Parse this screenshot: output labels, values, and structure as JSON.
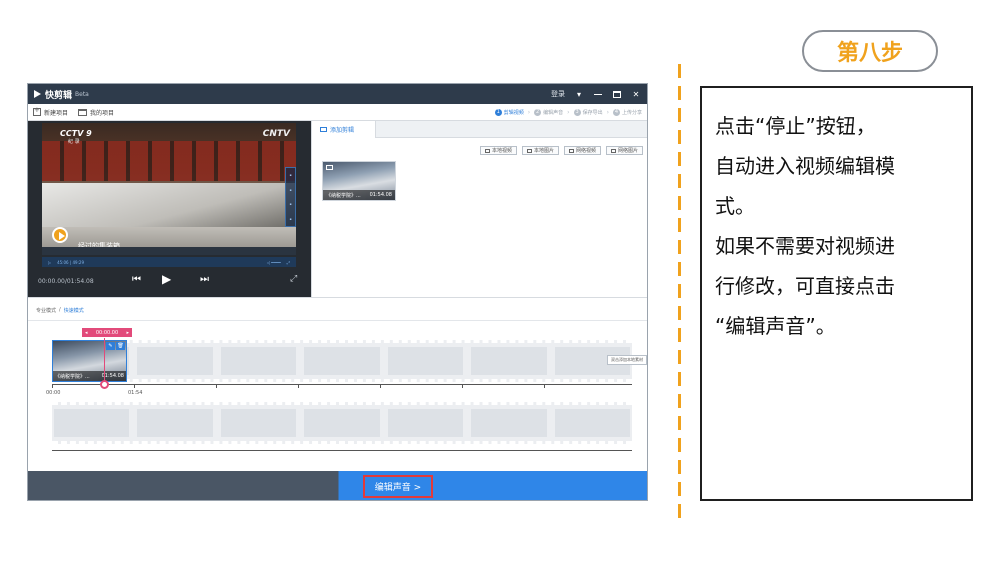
{
  "app": {
    "name": "快剪辑",
    "beta": "Beta",
    "login": "登录",
    "toolbar": {
      "new_project": "新建项目",
      "my_projects": "我的项目"
    },
    "steps": [
      {
        "num": "1",
        "label": "剪辑视频",
        "active": true
      },
      {
        "num": "2",
        "label": "编辑声音",
        "active": false
      },
      {
        "num": "3",
        "label": "保存导出",
        "active": false
      },
      {
        "num": "4",
        "label": "上传分享",
        "active": false
      }
    ],
    "preview": {
      "channel_left": "CCTV 9",
      "channel_sub": "纪 录",
      "channel_right": "CNTV",
      "subtitle": "经过的集装箱",
      "mini_time": "45:06 | 49:29",
      "time": "00:00.00/01:54.08"
    },
    "materials": {
      "tab": "添加剪辑",
      "buttons": [
        "本地视频",
        "本地图片",
        "网络视频",
        "网络图片"
      ],
      "thumb_title": "《纳税学院》...",
      "thumb_duration": "01:54.08"
    },
    "timeline": {
      "mode_pro": "专业模式",
      "mode_sep": "/",
      "mode_fast": "快速模式",
      "timecode": "00:00.00",
      "clip_title": "《纳税学院》...",
      "clip_duration": "01:54.08",
      "add_hint": "双击添加本地素材",
      "ruler_start": "00:00",
      "ruler_mark": "01:54"
    },
    "next_button": "编辑声音 >"
  },
  "step_label": "第八步",
  "instruction": {
    "line1": "点击“停止”按钮，",
    "line2": "自动进入视频编辑模",
    "line3": "式。",
    "line4": "如果不需要对视频进",
    "line5": "行修改，可直接点击",
    "line6": "“编辑声音”。"
  },
  "colors": {
    "accent_orange": "#f0a21d",
    "highlight_red": "#e23a3a",
    "brand_blue": "#2f86e8",
    "timecode_pink": "#e24a7a"
  }
}
